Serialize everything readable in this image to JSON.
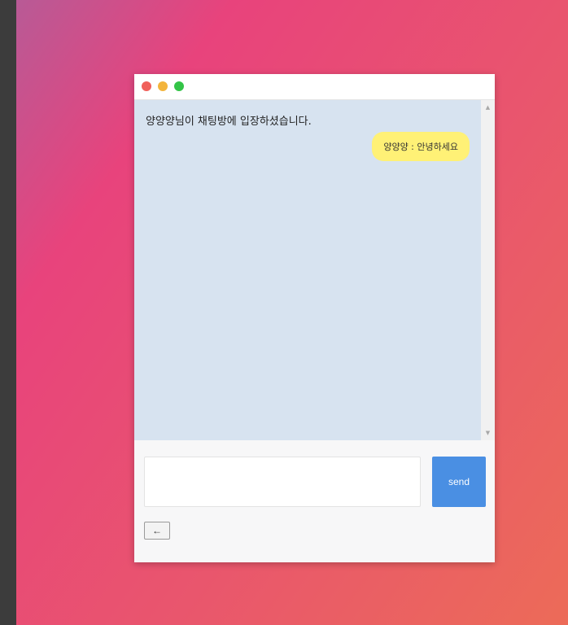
{
  "window": {
    "controls": [
      "close",
      "minimize",
      "maximize"
    ]
  },
  "chat": {
    "system_message": "양양양님이 채팅방에 입장하셨습니다.",
    "messages": [
      {
        "text": "양양양 : 안녕하세요",
        "own": true
      }
    ]
  },
  "scrollbar": {
    "up_arrow": "▲",
    "down_arrow": "▼"
  },
  "input": {
    "value": "",
    "placeholder": ""
  },
  "buttons": {
    "send_label": "send",
    "back_label": "←"
  },
  "colors": {
    "bubble": "#fff176",
    "chat_background": "#d7e3f0",
    "send_button": "#4a8fe3"
  }
}
